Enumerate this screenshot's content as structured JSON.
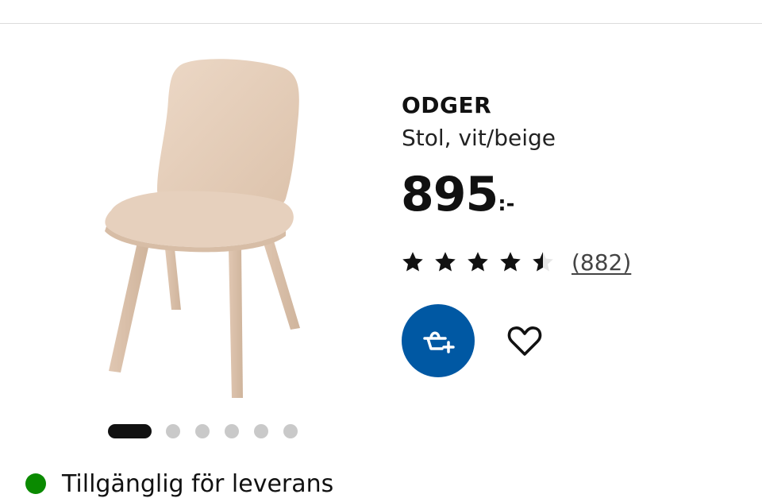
{
  "product": {
    "name": "ODGER",
    "description": "Stol, vit/beige",
    "price": "895",
    "price_suffix": ":-",
    "rating": 4.5,
    "rating_max": 5,
    "review_count": "(882)",
    "image_icon": "chair-image",
    "chair_color": "#e8d2be"
  },
  "actions": {
    "cart_icon": "add-to-basket-icon",
    "favorite_icon": "heart-outline-icon",
    "cart_color": "#0058a3"
  },
  "carousel": {
    "active_index": 0,
    "count": 6
  },
  "availability": {
    "text": "Tillgänglig för leverans",
    "status_color": "#0a8a00"
  }
}
